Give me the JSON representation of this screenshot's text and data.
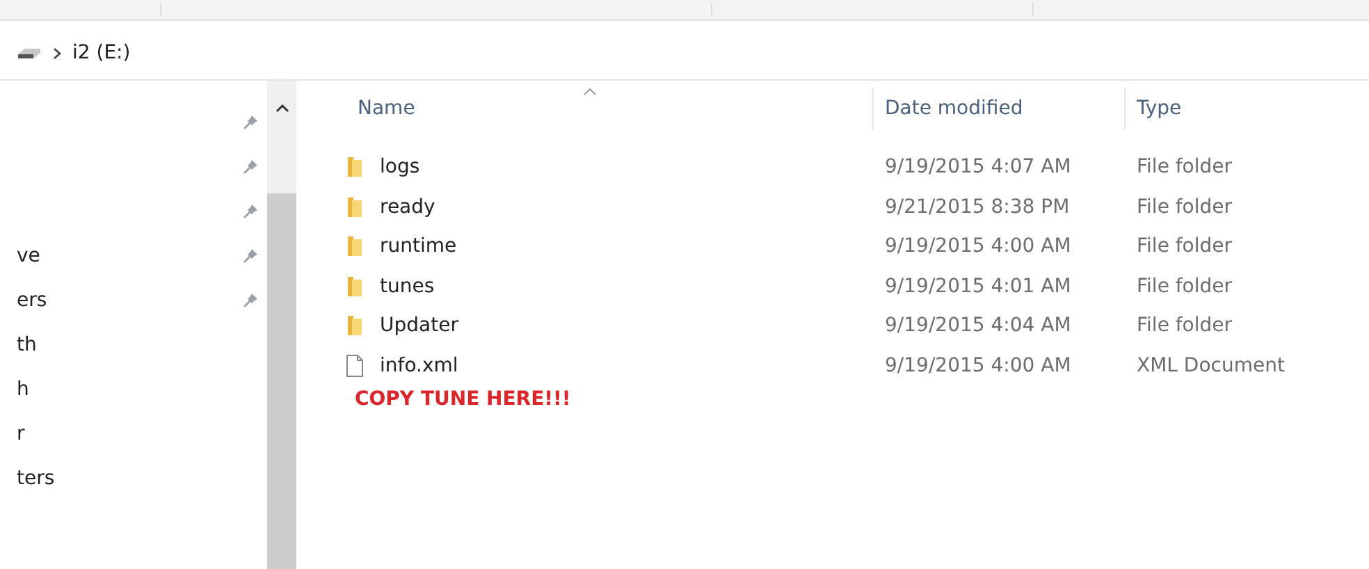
{
  "address_bar": {
    "path": [
      {
        "label": "i2 (E:)"
      }
    ]
  },
  "nav_pane": {
    "items": [
      {
        "pinned": true
      },
      {
        "pinned": true
      },
      {
        "pinned": true
      },
      {
        "label": "ve",
        "pinned": true
      },
      {
        "label": "ers",
        "pinned": true
      },
      {
        "label": "th",
        "pinned": false
      },
      {
        "label": "h",
        "pinned": false
      },
      {
        "label": "r",
        "pinned": false
      },
      {
        "label": "ters",
        "pinned": false
      }
    ]
  },
  "table": {
    "columns": [
      {
        "label": "Name",
        "sorted": true
      },
      {
        "label": "Date modified",
        "sorted": false
      },
      {
        "label": "Type",
        "sorted": false
      }
    ],
    "rows": [
      {
        "kind": "folder",
        "name": "logs",
        "date": "9/19/2015 4:07 AM",
        "type": "File folder"
      },
      {
        "kind": "folder",
        "name": "ready",
        "date": "9/21/2015 8:38 PM",
        "type": "File folder"
      },
      {
        "kind": "folder",
        "name": "runtime",
        "date": "9/19/2015 4:00 AM",
        "type": "File folder"
      },
      {
        "kind": "folder",
        "name": "tunes",
        "date": "9/19/2015 4:01 AM",
        "type": "File folder"
      },
      {
        "kind": "folder",
        "name": "Updater",
        "date": "9/19/2015 4:04 AM",
        "type": "File folder"
      },
      {
        "kind": "file",
        "name": "info.xml",
        "date": "9/19/2015 4:00 AM",
        "type": "XML Document"
      }
    ]
  },
  "annotation": {
    "text": "COPY TUNE HERE!!!"
  }
}
